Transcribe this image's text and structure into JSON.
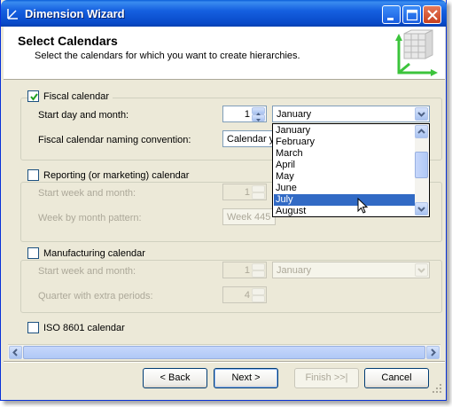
{
  "window": {
    "title": "Dimension Wizard"
  },
  "header": {
    "title": "Select Calendars",
    "subtitle": "Select the calendars for which you want to create hierarchies."
  },
  "fiscal": {
    "checkbox_label": "Fiscal calendar",
    "checked": true,
    "start_label": "Start day and month:",
    "start_day": "1",
    "start_month": "January",
    "naming_label": "Fiscal calendar naming convention:",
    "naming_value": "Calendar y"
  },
  "month_dropdown": {
    "options": [
      "January",
      "February",
      "March",
      "April",
      "May",
      "June",
      "July",
      "August"
    ],
    "selected": "July"
  },
  "reporting": {
    "checkbox_label": "Reporting (or marketing) calendar",
    "checked": false,
    "start_label": "Start week and month:",
    "start_week": "1",
    "pattern_label": "Week by month pattern:",
    "pattern_value": "Week 445"
  },
  "manufacturing": {
    "checkbox_label": "Manufacturing calendar",
    "checked": false,
    "start_label": "Start week and month:",
    "start_week": "1",
    "start_month": "January",
    "quarter_label": "Quarter with extra periods:",
    "quarter_value": "4"
  },
  "iso": {
    "checkbox_label": "ISO 8601 calendar",
    "checked": false
  },
  "buttons": {
    "back": "< Back",
    "next": "Next >",
    "finish": "Finish >>|",
    "cancel": "Cancel"
  },
  "colors": {
    "titlebar": "#0a5fd8",
    "selection": "#316ac5",
    "disabled_text": "#aca899"
  }
}
